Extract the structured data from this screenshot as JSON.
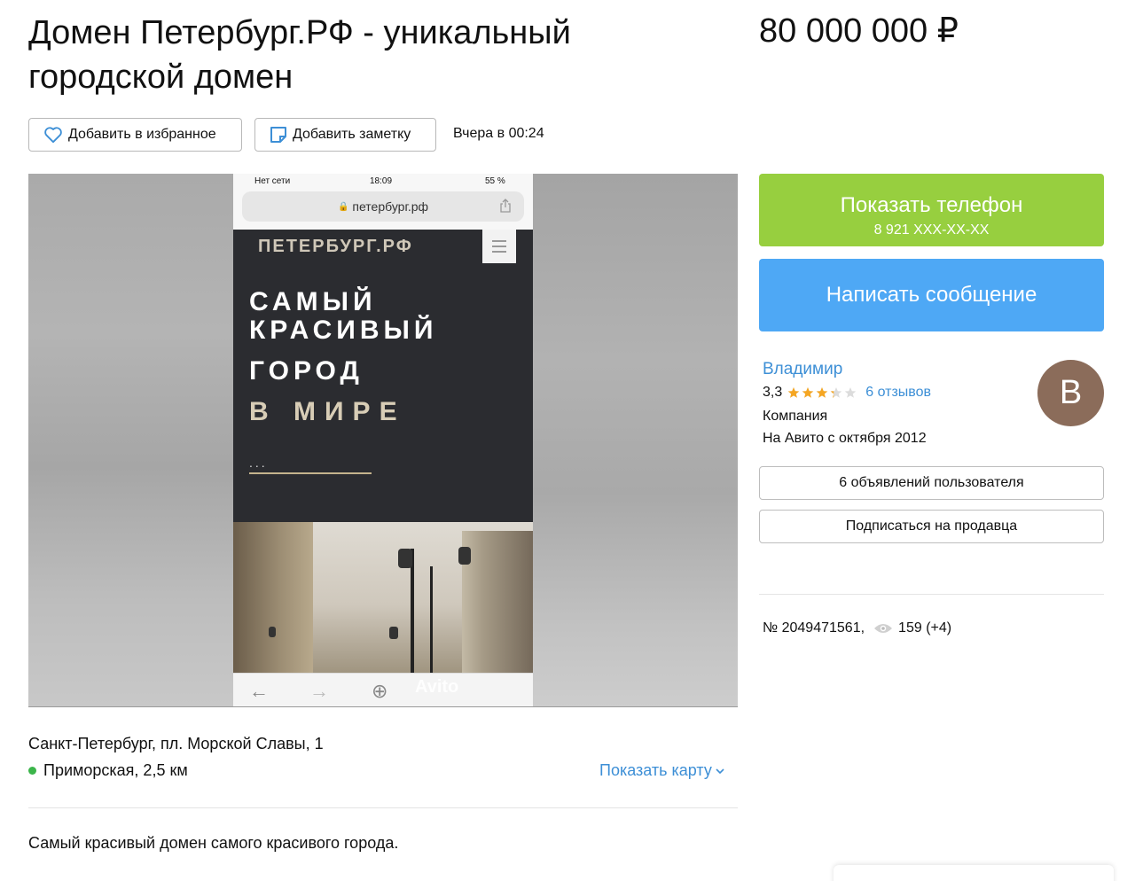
{
  "listing": {
    "title": "Домен Петербург.РФ - уникальный городской домен",
    "price": "80 000 000 ₽",
    "posted": "Вчера в 00:24",
    "favorite_label": "Добавить в избранное",
    "note_label": "Добавить заметку",
    "address": "Санкт-Петербург, пл. Морской Славы, 1",
    "metro": "Приморская, 2,5 км",
    "show_map": "Показать карту",
    "description": "Самый красивый домен самого красивого города.",
    "number": "№ 2049471561,",
    "views": "159 (+4)"
  },
  "photo": {
    "status_carrier": "Нет сети",
    "status_time": "18:09",
    "status_battery": "55 %",
    "url": "петербург.рф",
    "site_logo": "ПЕТЕРБУРГ.РФ",
    "hero_line1": "САМЫЙ",
    "hero_line2": "КРАСИВЫЙ",
    "hero_line3": "ГОРОД",
    "hero_line4": "В МИРЕ",
    "dots": "...",
    "watermark": "Avito"
  },
  "contact": {
    "call_label": "Показать телефон",
    "phone_masked": "8 921 XXX-XX-XX",
    "message_label": "Написать сообщение"
  },
  "seller": {
    "name": "Владимир",
    "rating": "3,3",
    "rating_value": 3.3,
    "rating_max": 5,
    "reviews": "6 отзывов",
    "type": "Компания",
    "since": "На Авито с октября 2012",
    "avatar_letter": "В",
    "ads_label": "6 объявлений пользователя",
    "subscribe_label": "Подписаться на продавца"
  },
  "colors": {
    "call_button": "#97cf3f",
    "message_button": "#4ea8f5",
    "link": "#3d8fd6",
    "metro_dot": "#3bb54a",
    "star": "#f5a623"
  },
  "icons": {
    "favorite": "heart-icon",
    "note": "note-icon",
    "views": "eye-icon",
    "map_toggle": "chevron-down-icon"
  }
}
